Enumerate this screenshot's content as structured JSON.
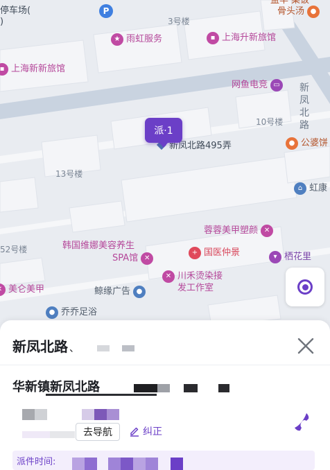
{
  "map": {
    "dispatch_marker_label": "派·1",
    "roads": {
      "top_left_partial": "停车场(",
      "top_left_partial2": ")",
      "right_vertical": "新凤北路",
      "lane_label": "新凤北路495弄"
    },
    "buildings": {
      "b3": "3号楼",
      "b10": "10号楼",
      "b13": "13号楼",
      "b52": "52号楼"
    },
    "pois": {
      "yuhong": "雨虹服务",
      "shanghai_sheng": "上海升新旅馆",
      "shanghai_xinxin": "上海新新旅馆",
      "wangyu": "网鱼电竞",
      "gongpo": "公婆饼",
      "hongkang": "虹康",
      "ronrong": "蓉蓉美甲塑颜",
      "hanguo": "韩国维娜美容养生",
      "hanguo2": "SPA馆",
      "guoyi": "国医仲景",
      "qihuali": "栖花里",
      "meilun": "美仑美甲",
      "chuanhe": "川禾烫染接",
      "chuanhe2": "发工作室",
      "jingyuan": "鲸缘广告",
      "qiaoqiao": "乔乔足浴",
      "top_right_1": "益羊 菜饭",
      "top_right_2": "骨头汤"
    },
    "icons": {
      "parking": "P"
    }
  },
  "sheet": {
    "title": "新凤北路",
    "title_suffix": "、",
    "address": "华新镇新凤北路",
    "nav_button": "去导航",
    "correct_link": "纠正",
    "dispatch_time_label": "派件时间:"
  },
  "colors": {
    "accent": "#6b3fc7",
    "poi_pink": "#c04aa3"
  }
}
